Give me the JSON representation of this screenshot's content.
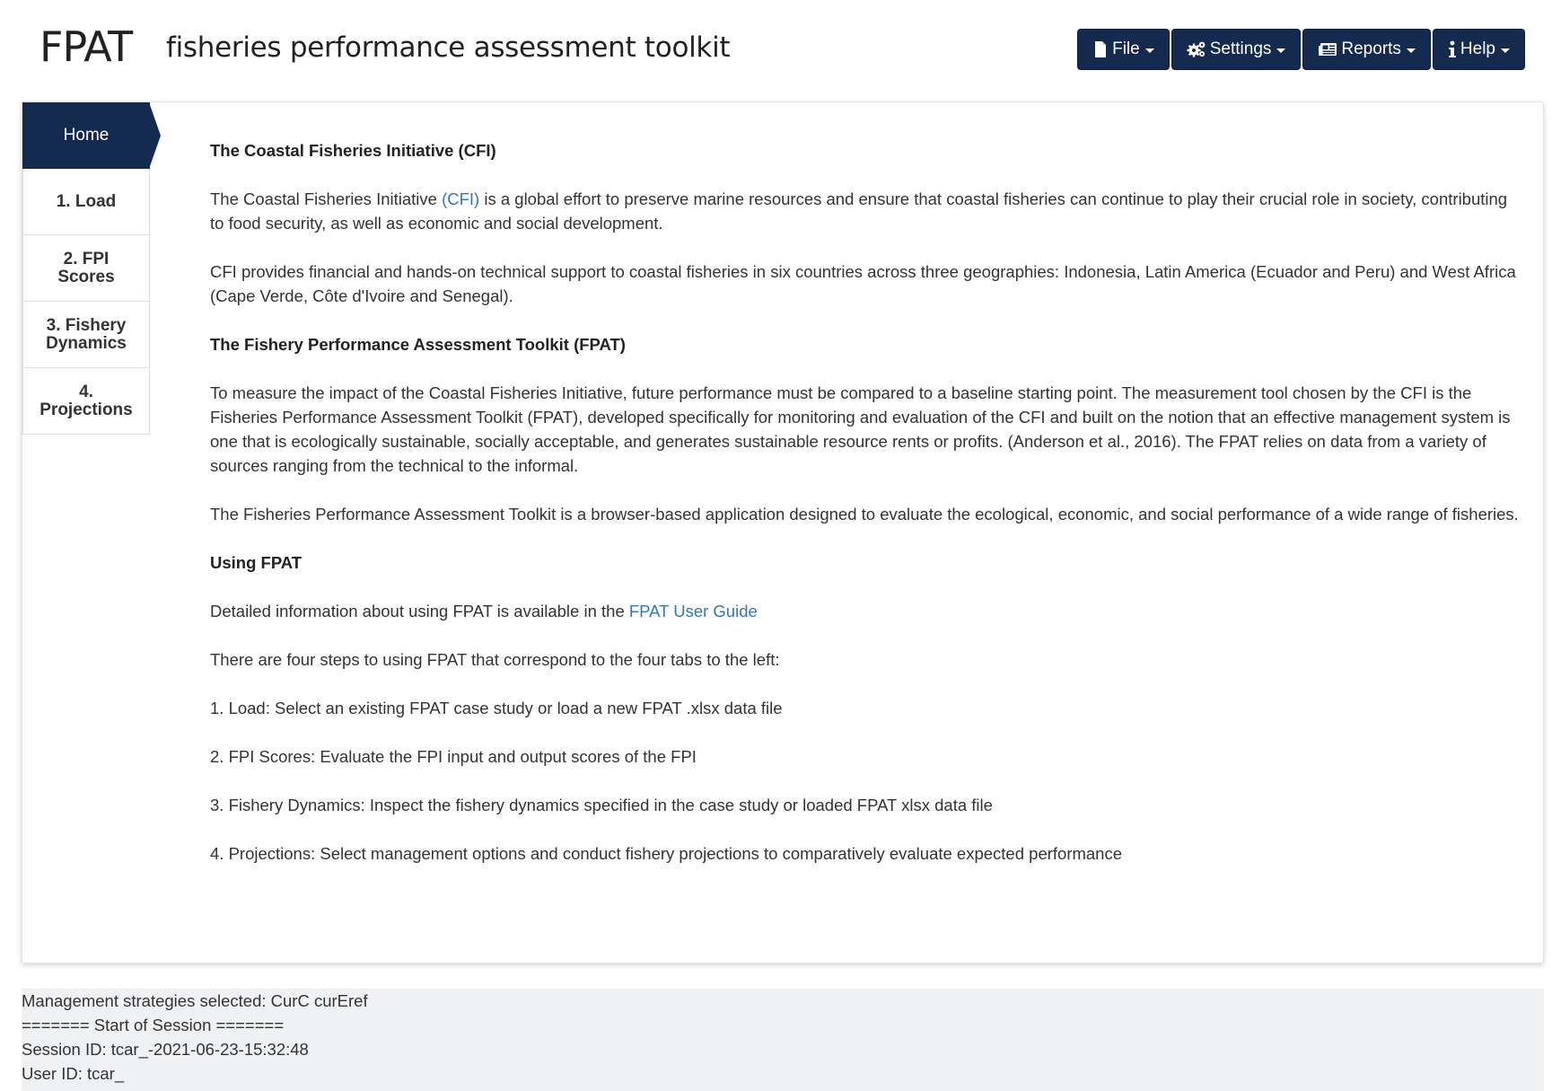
{
  "header": {
    "logo": "FPAT",
    "subtitle": "fisheries performance assessment toolkit"
  },
  "menu": [
    {
      "label": "File",
      "icon": "file-icon"
    },
    {
      "label": "Settings",
      "icon": "gears-icon"
    },
    {
      "label": "Reports",
      "icon": "newspaper-icon"
    },
    {
      "label": "Help",
      "icon": "info-icon"
    }
  ],
  "tabs": [
    {
      "label": "Home",
      "active": true
    },
    {
      "label": "1. Load"
    },
    {
      "label_line1": "2. FPI",
      "label_line2": "Scores"
    },
    {
      "label_line1": "3. Fishery",
      "label_line2": "Dynamics"
    },
    {
      "label_line1": "4.",
      "label_line2": "Projections"
    }
  ],
  "content": {
    "heading1": "The Coastal Fisheries Initiative (CFI)",
    "p1_before": "The Coastal Fisheries Initiative ",
    "p1_link": "(CFI)",
    "p1_after": " is a global effort to preserve marine resources and ensure that coastal fisheries can continue to play their crucial role in society, contributing to food security, as well as economic and social development.",
    "p2": "CFI provides financial and hands-on technical support to coastal fisheries in six countries across three geographies: Indonesia, Latin America (Ecuador and Peru) and West Africa (Cape Verde, Côte d'Ivoire and Senegal).",
    "heading2": "The Fishery Performance Assessment Toolkit (FPAT)",
    "p3": "To measure the impact of the Coastal Fisheries Initiative, future performance must be compared to a baseline starting point. The measurement tool chosen by the CFI is the Fisheries Performance Assessment Toolkit (FPAT), developed specifically for monitoring and evaluation of the CFI and built on the notion that an effective management system is one that is ecologically sustainable, socially acceptable, and generates sustainable resource rents or profits. (Anderson et al., 2016). The FPAT relies on data from a variety of sources ranging from the technical to the informal.",
    "p4": "The Fisheries Performance Assessment Toolkit is a browser-based application designed to evaluate the ecological, economic, and social performance of a wide range of fisheries.",
    "heading3": "Using FPAT",
    "p5_before": "Detailed information about using FPAT is available in the ",
    "p5_link": "FPAT User Guide",
    "p6": "There are four steps to using FPAT that correspond to the four tabs to the left:",
    "step1": "1. Load: Select an existing FPAT case study or load a new FPAT .xlsx data file",
    "step2": "2. FPI Scores: Evaluate the FPI input and output scores of the FPI",
    "step3": "3. Fishery Dynamics: Inspect the fishery dynamics specified in the case study or loaded FPAT xlsx data file",
    "step4": "4. Projections: Select management options and conduct fishery projections to comparatively evaluate expected performance"
  },
  "log": {
    "line1": "Management strategies selected: CurC curEref",
    "line2": "======= Start of Session =======",
    "line3": "Session ID: tcar_-2021-06-23-15:32:48",
    "line4": "User ID: tcar_"
  },
  "colors": {
    "navy": "#142a4f",
    "link": "#2f7ab7",
    "log_bg": "#f0f1f3"
  }
}
